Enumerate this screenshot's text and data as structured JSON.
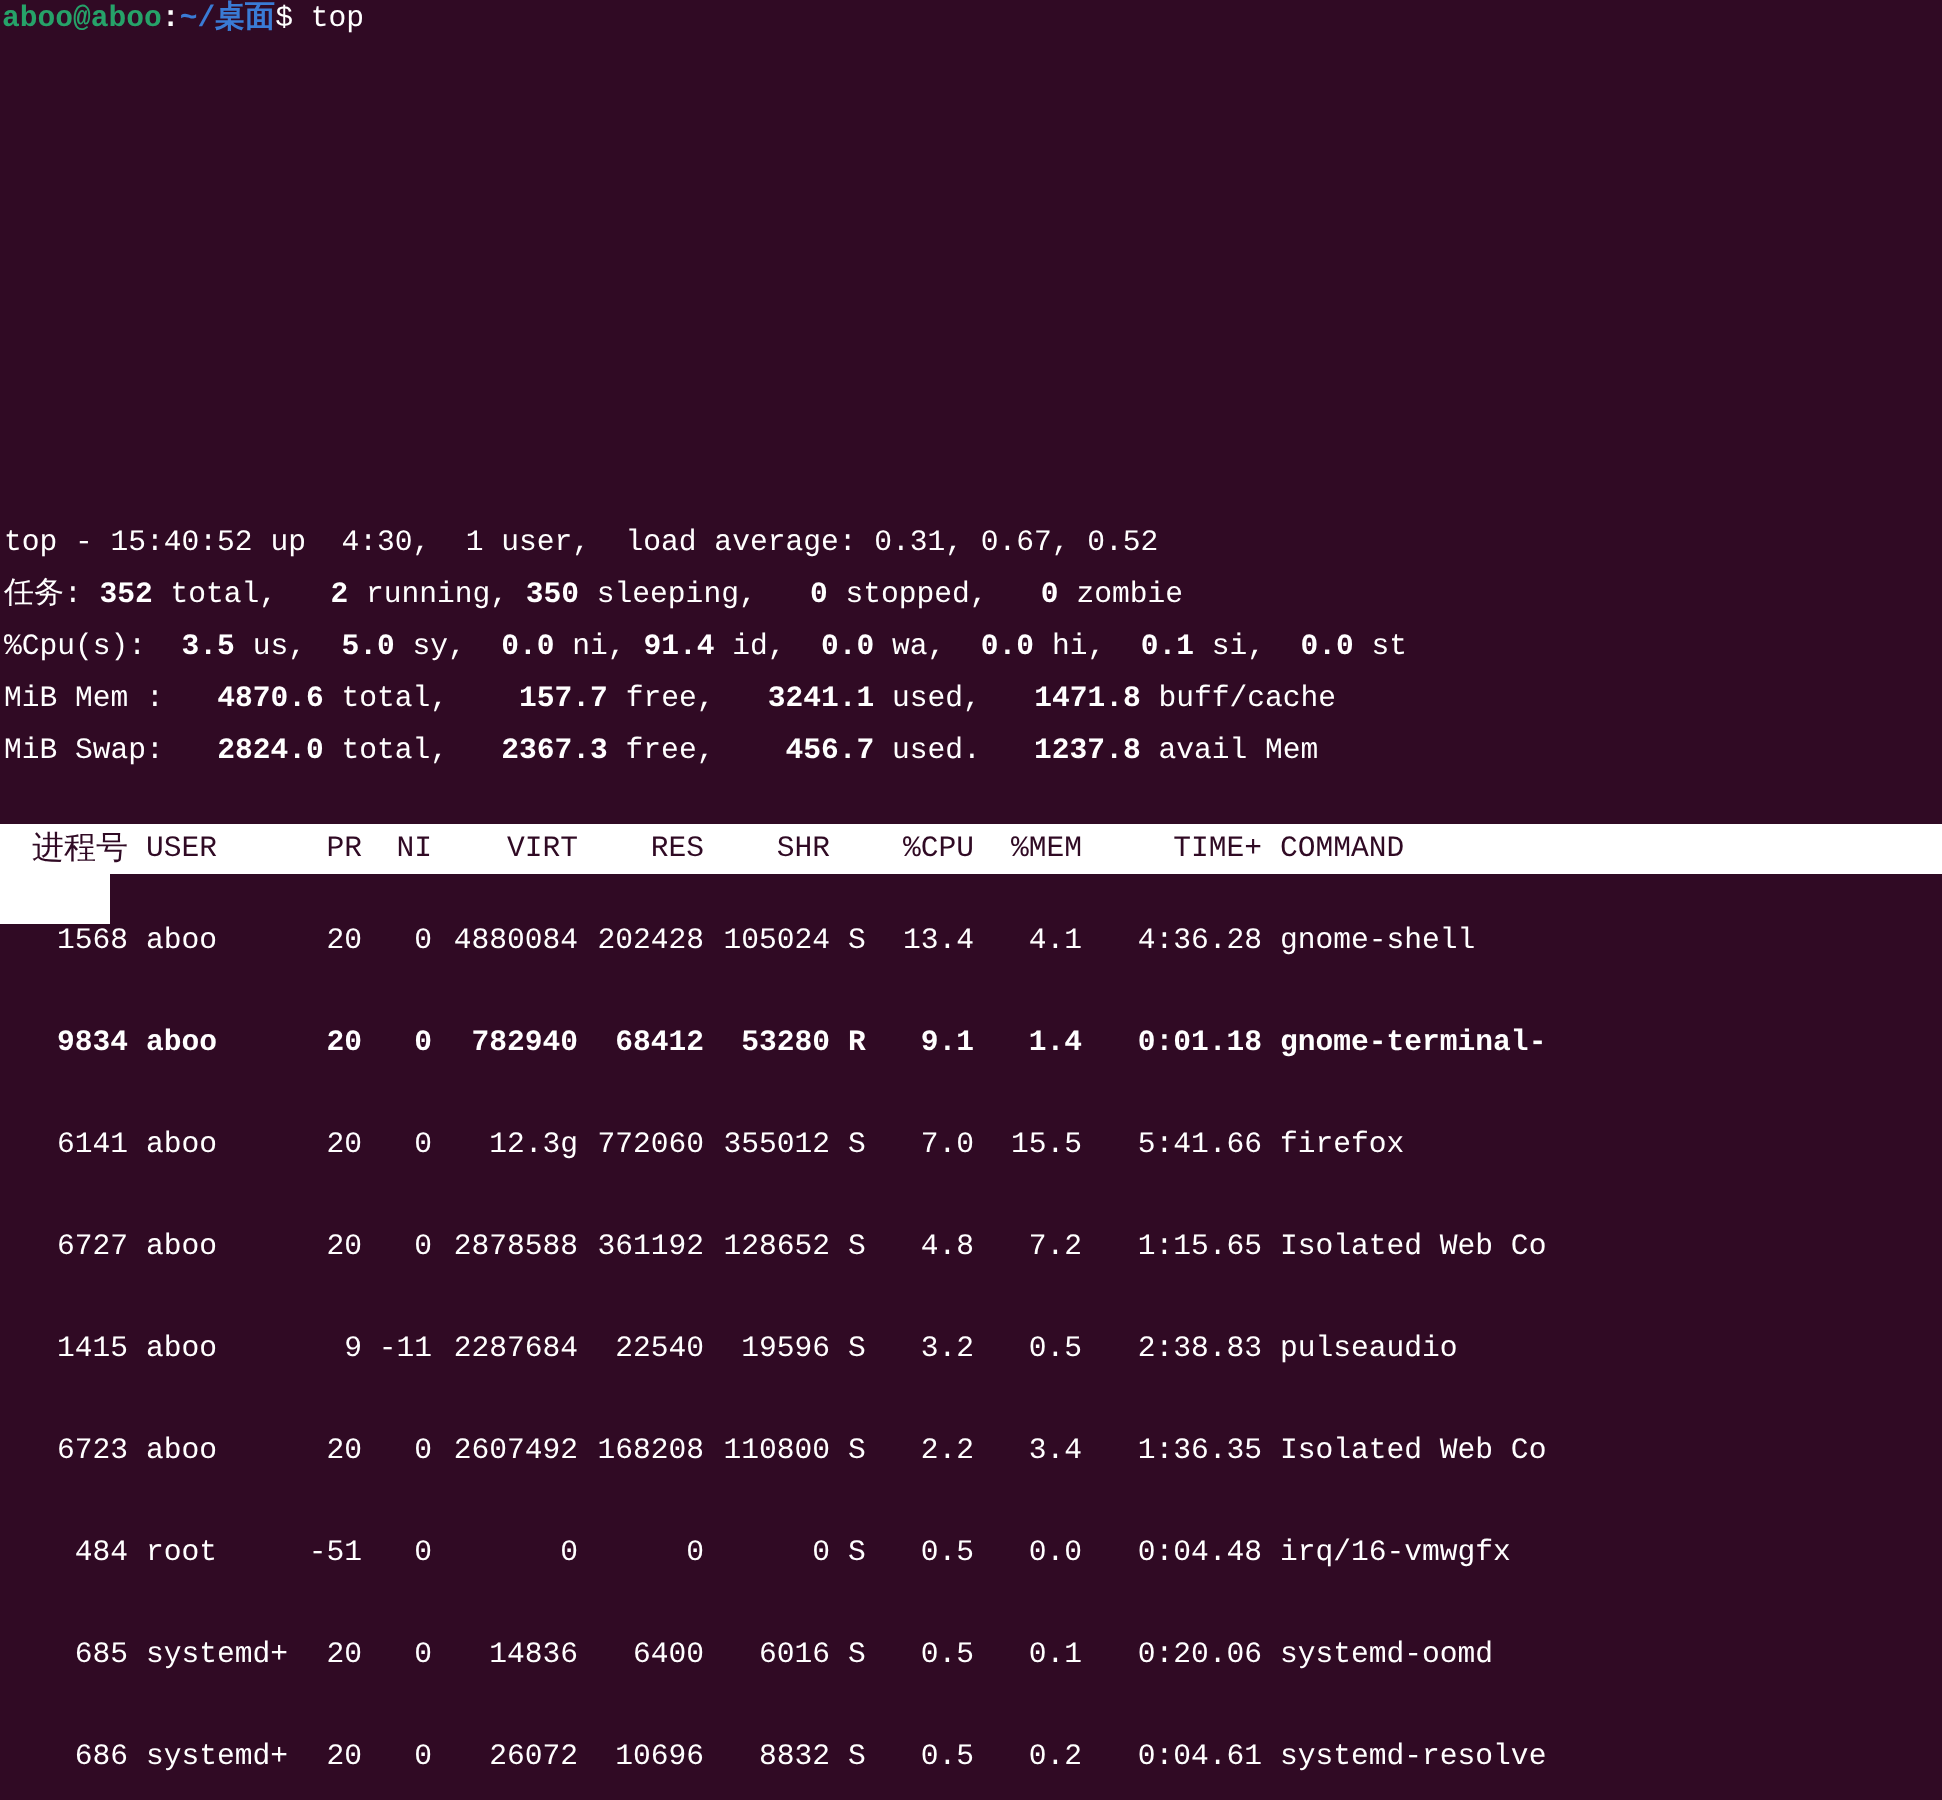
{
  "prompt": {
    "user_host": "aboo@aboo",
    "separator": ":",
    "path": "~/桌面",
    "symbol": "$",
    "command": "top"
  },
  "summary": [
    "top - 15:40:52 up  4:30,  1 user,  load average: 0.31, 0.67, 0.52",
    "任务: **352** total,   **2** running, **350** sleeping,   **0** stopped,   **0** zombie",
    "%Cpu(s):  **3.5** us,  **5.0** sy,  **0.0** ni, **91.4** id,  **0.0** wa,  **0.0** hi,  **0.1** si,  **0.0** st",
    "MiB Mem :   **4870.6** total,    **157.7** free,   **3241.1** used,   **1471.8** buff/cache",
    "MiB Swap:   **2824.0** total,   **2367.3** free,    **456.7** used.   **1237.8** avail Mem"
  ],
  "columns": [
    "进程号",
    "USER",
    "PR",
    "NI",
    "VIRT",
    "RES",
    "SHR",
    "",
    "%CPU",
    "%MEM",
    "TIME+",
    "COMMAND"
  ],
  "rows": [
    {
      "highlighted": false,
      "cells": [
        "1568",
        "aboo",
        "20",
        "0",
        "4880084",
        "202428",
        "105024",
        "S",
        "13.4",
        "4.1",
        "4:36.28",
        "gnome-shell"
      ]
    },
    {
      "highlighted": true,
      "cells": [
        "9834",
        "aboo",
        "20",
        "0",
        "782940",
        "68412",
        "53280",
        "R",
        "9.1",
        "1.4",
        "0:01.18",
        "gnome-terminal-"
      ]
    },
    {
      "highlighted": false,
      "cells": [
        "6141",
        "aboo",
        "20",
        "0",
        "12.3g",
        "772060",
        "355012",
        "S",
        "7.0",
        "15.5",
        "5:41.66",
        "firefox"
      ]
    },
    {
      "highlighted": false,
      "cells": [
        "6727",
        "aboo",
        "20",
        "0",
        "2878588",
        "361192",
        "128652",
        "S",
        "4.8",
        "7.2",
        "1:15.65",
        "Isolated Web Co"
      ]
    },
    {
      "highlighted": false,
      "cells": [
        "1415",
        "aboo",
        "9",
        "-11",
        "2287684",
        "22540",
        "19596",
        "S",
        "3.2",
        "0.5",
        "2:38.83",
        "pulseaudio"
      ]
    },
    {
      "highlighted": false,
      "cells": [
        "6723",
        "aboo",
        "20",
        "0",
        "2607492",
        "168208",
        "110800",
        "S",
        "2.2",
        "3.4",
        "1:36.35",
        "Isolated Web Co"
      ]
    },
    {
      "highlighted": false,
      "cells": [
        "484",
        "root",
        "-51",
        "0",
        "0",
        "0",
        "0",
        "S",
        "0.5",
        "0.0",
        "0:04.48",
        "irq/16-vmwgfx"
      ]
    },
    {
      "highlighted": false,
      "cells": [
        "685",
        "systemd+",
        "20",
        "0",
        "14836",
        "6400",
        "6016",
        "S",
        "0.5",
        "0.1",
        "0:20.06",
        "systemd-oomd"
      ]
    },
    {
      "highlighted": false,
      "cells": [
        "686",
        "systemd+",
        "20",
        "0",
        "26072",
        "10696",
        "8832",
        "S",
        "0.5",
        "0.2",
        "0:04.61",
        "systemd-resolve"
      ]
    }
  ]
}
